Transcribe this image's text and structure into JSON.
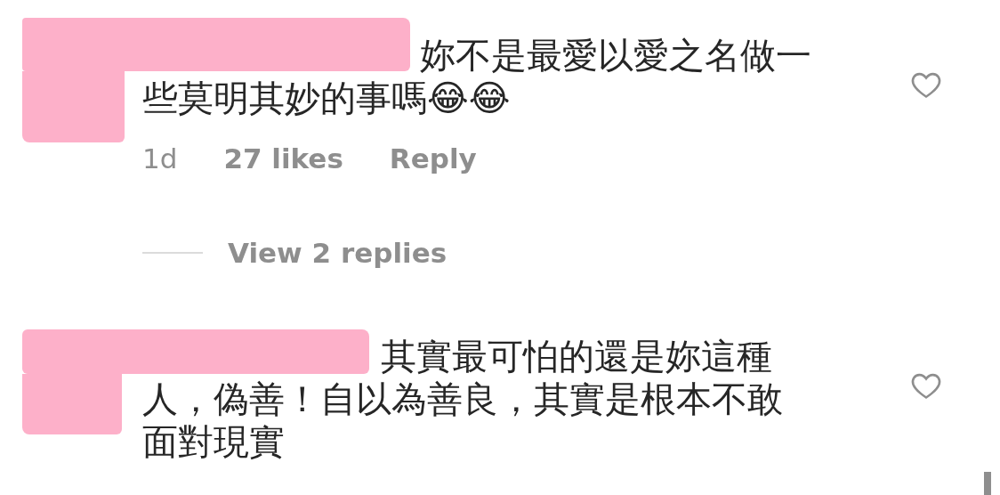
{
  "comments": [
    {
      "text_lines": [
        "妳不是最愛以愛之名做一",
        "些莫明其妙的事嗎😂😂"
      ],
      "time": "1d",
      "likes": "27 likes",
      "reply": "Reply",
      "liked": false,
      "view_replies": "View 2 replies"
    },
    {
      "text_lines": [
        "其實最可怕的還是妳這種",
        "人，偽善！自以為善良，其實是根本不敢",
        "面對現實"
      ],
      "liked": false
    }
  ]
}
